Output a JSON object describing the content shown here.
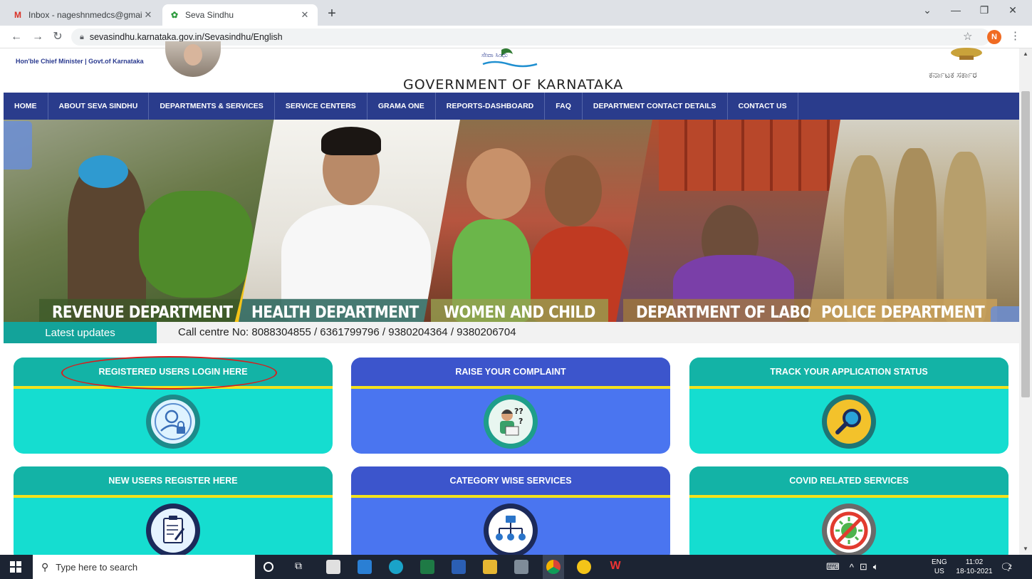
{
  "browser": {
    "tabs": [
      {
        "title": "Inbox - nageshnmedcs@gmail.cc",
        "icon": "gmail-icon"
      },
      {
        "title": "Seva Sindhu",
        "icon": "seva-sindhu-icon"
      }
    ],
    "url": "sevasindhu.karnataka.gov.in/Sevasindhu/English",
    "profile_initial": "N"
  },
  "header": {
    "cm_caption": "Hon'ble Chief Minister | Govt.of Karnataka",
    "logo_text": "ಸೇವಾ ಸಿಂಧು",
    "title": "GOVERNMENT OF KARNATAKA",
    "kannada_caption": "ಕರ್ನಾಟಕ ಸರ್ಕಾರ"
  },
  "menu": [
    "HOME",
    "ABOUT SEVA SINDHU",
    "DEPARTMENTS & SERVICES",
    "SERVICE CENTERS",
    "GRAMA ONE",
    "REPORTS-DASHBOARD",
    "FAQ",
    "DEPARTMENT CONTACT DETAILS",
    "CONTACT US"
  ],
  "banner": {
    "departments": [
      "REVENUE DEPARTMENT",
      "HEALTH DEPARTMENT",
      "WOMEN AND CHILD",
      "DEPARTMENT OF LABOUR",
      "POLICE DEPARTMENT"
    ]
  },
  "updates": {
    "label": "Latest updates",
    "call_centre": "Call centre No: 8088304855 / 6361799796 / 9380204364 / 9380206704"
  },
  "tiles": [
    {
      "title": "REGISTERED USERS LOGIN HERE",
      "icon": "user-lock-icon",
      "color": "#15ddd0"
    },
    {
      "title": "RAISE YOUR COMPLAINT",
      "icon": "complaint-person-icon",
      "color": "#4a75f0"
    },
    {
      "title": "TRACK YOUR APPLICATION STATUS",
      "icon": "magnifier-icon",
      "color": "#15ddd0"
    },
    {
      "title": "NEW USERS REGISTER HERE",
      "icon": "clipboard-pen-icon",
      "color": "#15ddd0"
    },
    {
      "title": "CATEGORY WISE SERVICES",
      "icon": "hierarchy-icon",
      "color": "#4a75f0"
    },
    {
      "title": "COVID RELATED SERVICES",
      "icon": "no-covid-icon",
      "color": "#15ddd0"
    }
  ],
  "taskbar": {
    "search_placeholder": "Type here to search",
    "lang": "ENG",
    "region": "US",
    "time": "11:02",
    "date": "18-10-2021",
    "notification_count": "2"
  },
  "colors": {
    "menu_bg": "#2a3c8c",
    "tile_teal": "#15ddd0",
    "tile_blue": "#4a75f0",
    "highlight_oval": "#d81d1d",
    "accent_yellow": "#f4c418"
  }
}
